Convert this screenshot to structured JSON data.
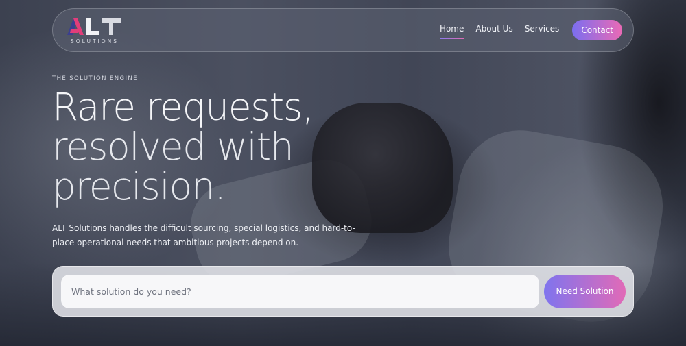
{
  "brand": {
    "logo_text": "ALT",
    "logo_subtitle": "SOLUTIONS",
    "logo_colors": [
      "#e23d7a",
      "#3b3f8f",
      "#f2f2f5"
    ]
  },
  "nav": {
    "items": [
      {
        "label": "Home",
        "active": true
      },
      {
        "label": "About Us",
        "active": false
      },
      {
        "label": "Services",
        "active": false
      }
    ],
    "contact_label": "Contact"
  },
  "hero": {
    "eyebrow": "THE SOLUTION ENGINE",
    "headline_lines": [
      "Rare requests,",
      "resolved with",
      "precision."
    ],
    "lede": "ALT Solutions handles the difficult sourcing, special logistics, and hard-to-place operational needs that ambitious projects depend on."
  },
  "search": {
    "placeholder": "What solution do you need?",
    "button_label": "Need Solution"
  },
  "colors": {
    "accent_start": "#7b6ef0",
    "accent_end": "#ea6ab5"
  }
}
